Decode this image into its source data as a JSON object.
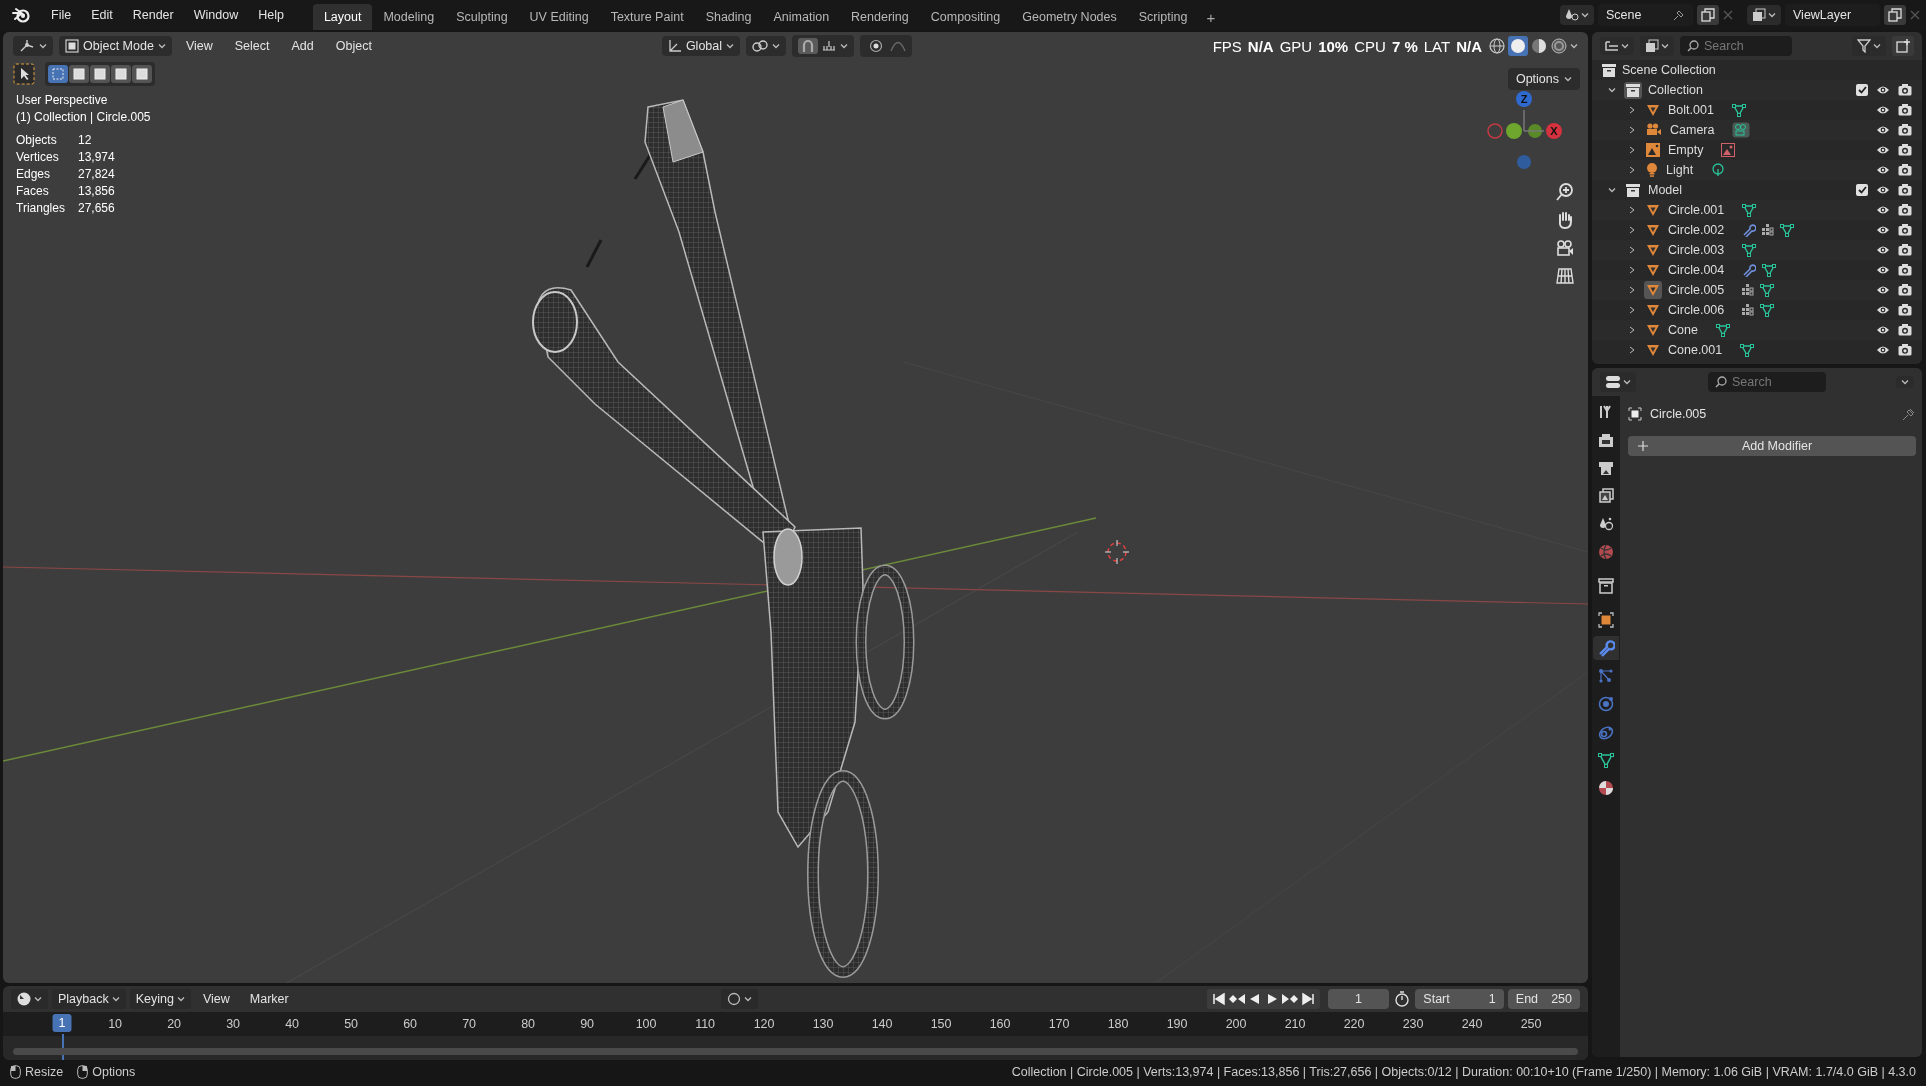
{
  "top_bar": {
    "menus": [
      "File",
      "Edit",
      "Render",
      "Window",
      "Help"
    ],
    "workspaces": [
      {
        "label": "Layout",
        "selected": true
      },
      {
        "label": "Modeling",
        "selected": false
      },
      {
        "label": "Sculpting",
        "selected": false
      },
      {
        "label": "UV Editing",
        "selected": false
      },
      {
        "label": "Texture Paint",
        "selected": false
      },
      {
        "label": "Shading",
        "selected": false
      },
      {
        "label": "Animation",
        "selected": false
      },
      {
        "label": "Rendering",
        "selected": false
      },
      {
        "label": "Compositing",
        "selected": false
      },
      {
        "label": "Geometry Nodes",
        "selected": false
      },
      {
        "label": "Scripting",
        "selected": false
      }
    ],
    "add_workspace": "+",
    "scene": "Scene",
    "view_layer": "ViewLayer"
  },
  "viewport": {
    "header": {
      "mode": "Object Mode",
      "menus": [
        "View",
        "Select",
        "Add",
        "Object"
      ],
      "orientation": "Global",
      "snap": {
        "on": true
      },
      "proportional_edit": {
        "on": false
      },
      "performance": [
        {
          "label": "FPS",
          "value": "N/A"
        },
        {
          "label": "GPU",
          "value": "10%"
        },
        {
          "label": "CPU",
          "value": "7 %"
        },
        {
          "label": "LAT",
          "value": "N/A"
        }
      ],
      "options": "Options"
    },
    "select_modes": [
      {
        "selected": true
      },
      {
        "selected": false
      },
      {
        "selected": false
      },
      {
        "selected": false
      },
      {
        "selected": false
      }
    ],
    "info": {
      "view": "User Perspective",
      "context": "(1) Collection | Circle.005",
      "stats": [
        {
          "label": "Objects",
          "value": "12"
        },
        {
          "label": "Vertices",
          "value": "13,974"
        },
        {
          "label": "Edges",
          "value": "27,824"
        },
        {
          "label": "Faces",
          "value": "13,856"
        },
        {
          "label": "Triangles",
          "value": "27,656"
        }
      ]
    },
    "gizmo_axes": [
      {
        "label": "Z",
        "color": "#2f6ad0"
      },
      {
        "label": "X",
        "color": "#d4323e"
      }
    ]
  },
  "outliner": {
    "search": {
      "placeholder": "Search"
    },
    "root": "Scene Collection",
    "collections": [
      {
        "name": "Collection",
        "expanded": true,
        "checked": true,
        "active": true,
        "children": [
          {
            "name": "Bolt.001",
            "kind": "mesh",
            "expanded": false,
            "active": false,
            "data": [
              {
                "kind": "mesh"
              }
            ]
          },
          {
            "name": "Camera",
            "kind": "camera",
            "expanded": false,
            "active": false,
            "data": [
              {
                "kind": "camera"
              }
            ]
          },
          {
            "name": "Empty",
            "kind": "empty",
            "expanded": false,
            "active": false,
            "data": [
              {
                "kind": "image"
              }
            ]
          },
          {
            "name": "Light",
            "kind": "light",
            "expanded": false,
            "active": false,
            "data": [
              {
                "kind": "light"
              }
            ]
          }
        ]
      },
      {
        "name": "Model",
        "expanded": true,
        "checked": true,
        "active": false,
        "children": [
          {
            "name": "Circle.001",
            "kind": "mesh",
            "expanded": false,
            "active": false,
            "data": [
              {
                "kind": "mesh"
              }
            ]
          },
          {
            "name": "Circle.002",
            "kind": "mesh",
            "expanded": false,
            "active": false,
            "data": [
              {
                "kind": "modifier"
              },
              {
                "kind": "dots"
              },
              {
                "kind": "mesh"
              }
            ]
          },
          {
            "name": "Circle.003",
            "kind": "mesh",
            "expanded": false,
            "active": false,
            "data": [
              {
                "kind": "mesh"
              }
            ]
          },
          {
            "name": "Circle.004",
            "kind": "mesh",
            "expanded": false,
            "active": false,
            "data": [
              {
                "kind": "modifier"
              },
              {
                "kind": "mesh"
              }
            ]
          },
          {
            "name": "Circle.005",
            "kind": "mesh",
            "expanded": false,
            "active": true,
            "data": [
              {
                "kind": "dots"
              },
              {
                "kind": "mesh"
              }
            ]
          },
          {
            "name": "Circle.006",
            "kind": "mesh",
            "expanded": false,
            "active": false,
            "data": [
              {
                "kind": "dots"
              },
              {
                "kind": "mesh"
              }
            ]
          },
          {
            "name": "Cone",
            "kind": "mesh",
            "expanded": false,
            "active": false,
            "data": [
              {
                "kind": "mesh"
              }
            ]
          },
          {
            "name": "Cone.001",
            "kind": "mesh",
            "expanded": false,
            "active": false,
            "data": [
              {
                "kind": "mesh"
              }
            ]
          }
        ]
      }
    ]
  },
  "properties": {
    "search": {
      "placeholder": "Search"
    },
    "tabs": [
      {
        "kind": "tool",
        "selected": false
      },
      {
        "kind": "render",
        "selected": false
      },
      {
        "kind": "output",
        "selected": false
      },
      {
        "kind": "view_layer",
        "selected": false
      },
      {
        "kind": "scene",
        "selected": false
      },
      {
        "kind": "world",
        "selected": false
      },
      {
        "kind": "collection",
        "selected": false
      },
      {
        "kind": "object",
        "selected": false
      },
      {
        "kind": "modifier",
        "selected": true
      },
      {
        "kind": "particles",
        "selected": false
      },
      {
        "kind": "physics",
        "selected": false
      },
      {
        "kind": "constraints",
        "selected": false
      },
      {
        "kind": "data",
        "selected": false
      },
      {
        "kind": "material",
        "selected": false
      }
    ],
    "object_name": "Circle.005",
    "add_modifier": "Add Modifier"
  },
  "timeline": {
    "menus": [
      "Playback",
      "Keying",
      "View",
      "Marker"
    ],
    "auto_keying": {
      "on": false
    },
    "current_frame": "1",
    "start_label": "Start",
    "start": "1",
    "end_label": "End",
    "end": "250",
    "ruler": [
      {
        "label": "1",
        "selected": true
      },
      {
        "label": "10",
        "selected": false
      },
      {
        "label": "20",
        "selected": false
      },
      {
        "label": "30",
        "selected": false
      },
      {
        "label": "40",
        "selected": false
      },
      {
        "label": "50",
        "selected": false
      },
      {
        "label": "60",
        "selected": false
      },
      {
        "label": "70",
        "selected": false
      },
      {
        "label": "80",
        "selected": false
      },
      {
        "label": "90",
        "selected": false
      },
      {
        "label": "100",
        "selected": false
      },
      {
        "label": "110",
        "selected": false
      },
      {
        "label": "120",
        "selected": false
      },
      {
        "label": "130",
        "selected": false
      },
      {
        "label": "140",
        "selected": false
      },
      {
        "label": "150",
        "selected": false
      },
      {
        "label": "160",
        "selected": false
      },
      {
        "label": "170",
        "selected": false
      },
      {
        "label": "180",
        "selected": false
      },
      {
        "label": "190",
        "selected": false
      },
      {
        "label": "200",
        "selected": false
      },
      {
        "label": "210",
        "selected": false
      },
      {
        "label": "220",
        "selected": false
      },
      {
        "label": "230",
        "selected": false
      },
      {
        "label": "240",
        "selected": false
      },
      {
        "label": "250",
        "selected": false
      }
    ]
  },
  "status_bar": {
    "hints": [
      {
        "kind": "mouse_left",
        "label": "Resize"
      },
      {
        "kind": "mouse_right",
        "label": "Options"
      }
    ],
    "info": "Collection | Circle.005 | Verts:13,974 | Faces:13,856 | Tris:27,656 | Objects:0/12 | Duration: 00:10+10 (Frame 1/250) | Memory: 1.06 GiB | VRAM: 1.7/4.0 GiB | 4.3.0"
  }
}
